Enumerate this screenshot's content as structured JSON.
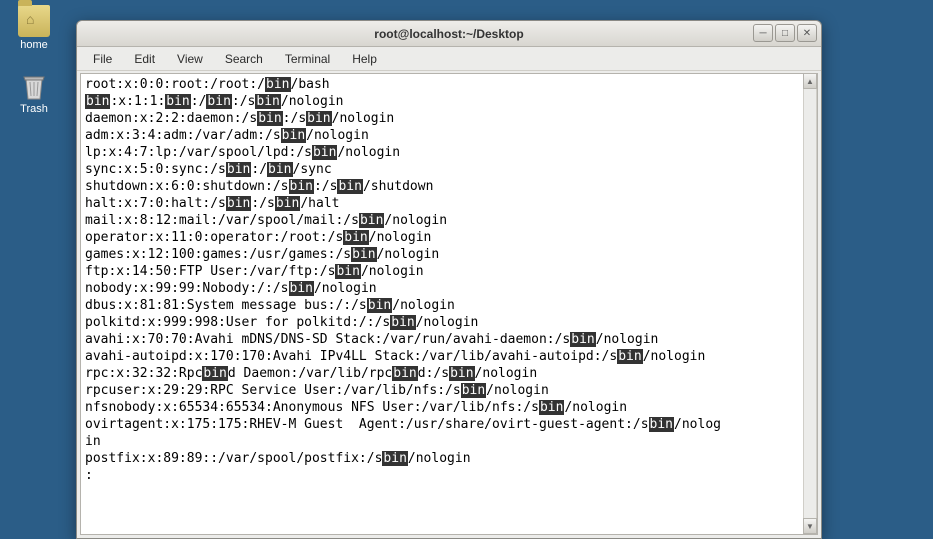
{
  "desktop": {
    "home_label": "home",
    "trash_label": "Trash"
  },
  "window": {
    "title": "root@localhost:~/Desktop"
  },
  "menu": {
    "file": "File",
    "edit": "Edit",
    "view": "View",
    "search": "Search",
    "terminal": "Terminal",
    "help": "Help"
  },
  "highlight_token": "bin",
  "terminal_lines": [
    "root:x:0:0:root:/root:/{bin}/bash",
    "{bin}:x:1:1:{bin}:/{bin}:/s{bin}/nologin",
    "daemon:x:2:2:daemon:/s{bin}:/s{bin}/nologin",
    "adm:x:3:4:adm:/var/adm:/s{bin}/nologin",
    "lp:x:4:7:lp:/var/spool/lpd:/s{bin}/nologin",
    "sync:x:5:0:sync:/s{bin}:/{bin}/sync",
    "shutdown:x:6:0:shutdown:/s{bin}:/s{bin}/shutdown",
    "halt:x:7:0:halt:/s{bin}:/s{bin}/halt",
    "mail:x:8:12:mail:/var/spool/mail:/s{bin}/nologin",
    "operator:x:11:0:operator:/root:/s{bin}/nologin",
    "games:x:12:100:games:/usr/games:/s{bin}/nologin",
    "ftp:x:14:50:FTP User:/var/ftp:/s{bin}/nologin",
    "nobody:x:99:99:Nobody:/:/s{bin}/nologin",
    "dbus:x:81:81:System message bus:/:/s{bin}/nologin",
    "polkitd:x:999:998:User for polkitd:/:/s{bin}/nologin",
    "avahi:x:70:70:Avahi mDNS/DNS-SD Stack:/var/run/avahi-daemon:/s{bin}/nologin",
    "avahi-autoipd:x:170:170:Avahi IPv4LL Stack:/var/lib/avahi-autoipd:/s{bin}/nologin",
    "rpc:x:32:32:Rpc{bin}d Daemon:/var/lib/rpc{bin}d:/s{bin}/nologin",
    "rpcuser:x:29:29:RPC Service User:/var/lib/nfs:/s{bin}/nologin",
    "nfsnobody:x:65534:65534:Anonymous NFS User:/var/lib/nfs:/s{bin}/nologin",
    "ovirtagent:x:175:175:RHEV-M Guest  Agent:/usr/share/ovirt-guest-agent:/s{bin}/nolog",
    "in",
    "postfix:x:89:89::/var/spool/postfix:/s{bin}/nologin",
    ":"
  ]
}
